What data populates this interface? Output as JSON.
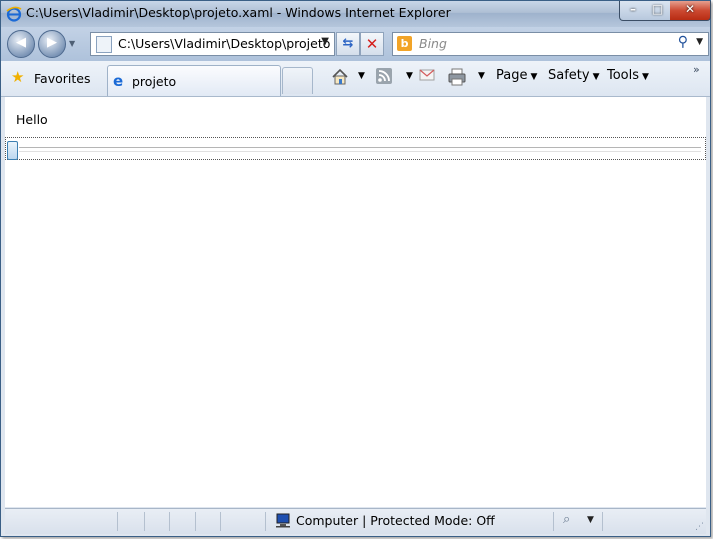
{
  "window": {
    "title": "C:\\Users\\Vladimir\\Desktop\\projeto.xaml - Windows Internet Explorer",
    "controls": {
      "minimize": "–",
      "maximize": "□",
      "close": "✕"
    }
  },
  "navigation": {
    "back_glyph": "◀",
    "forward_glyph": "▶",
    "address": "C:\\Users\\Vladimir\\Desktop\\projeto",
    "search_placeholder": "Bing",
    "search_logo": "b"
  },
  "favorites_bar": {
    "favorites_label": "Favorites",
    "tab_label": "projeto",
    "commands": [
      {
        "label": "Page",
        "name": "page-menu"
      },
      {
        "label": "Safety",
        "name": "safety-menu"
      },
      {
        "label": "Tools",
        "name": "tools-menu"
      }
    ]
  },
  "content": {
    "text": "Hello"
  },
  "status": {
    "zone": "Computer | Protected Mode: Off"
  },
  "icons": [
    "ie-icon",
    "back-icon",
    "forward-icon",
    "page-icon",
    "refresh-icon",
    "stop-icon",
    "bing-icon",
    "search-icon",
    "star-icon",
    "home-icon",
    "feeds-icon",
    "mail-icon",
    "print-icon",
    "computer-icon",
    "zoom-icon"
  ],
  "colors": {
    "accent": "#1b6ad6",
    "close": "#cc4a32",
    "titlebar": "#aebfd4"
  }
}
